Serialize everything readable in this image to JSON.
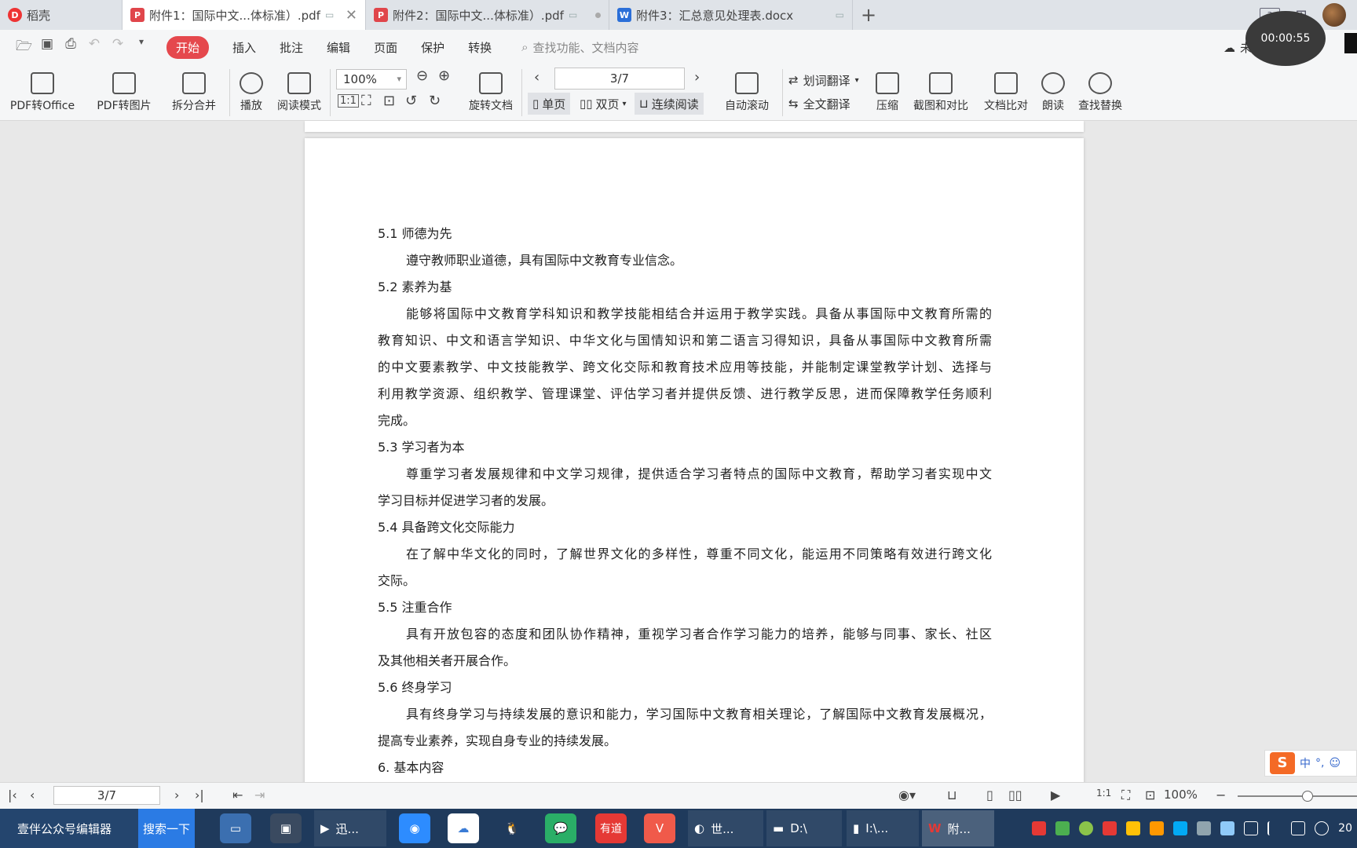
{
  "tabs": [
    {
      "label": "稻壳",
      "icon": "docer-icon"
    },
    {
      "label": "附件1：国际中文...体标准）.pdf",
      "icon": "pdf-icon",
      "active": true
    },
    {
      "label": "附件2：国际中文...体标准）.pdf",
      "icon": "pdf-icon"
    },
    {
      "label": "附件3：汇总意见处理表.docx",
      "icon": "word-icon"
    }
  ],
  "tabbar_right": {
    "badge": "3"
  },
  "menu": {
    "items": [
      "开始",
      "插入",
      "批注",
      "编辑",
      "页面",
      "保护",
      "转换"
    ],
    "search_placeholder": "查找功能、文档内容",
    "sync": "未同步"
  },
  "timer": "00:00:55",
  "ribbon": {
    "pdf_to_office": "PDF转Office",
    "pdf_to_image": "PDF转图片",
    "split_merge": "拆分合并",
    "play": "播放",
    "read_mode": "阅读模式",
    "zoom": "100%",
    "rotate": "旋转文档",
    "page_indicator": "3/7",
    "single_page": "单页",
    "double_page": "双页",
    "continuous": "连续阅读",
    "auto_scroll": "自动滚动",
    "word_translate": "划词翻译",
    "full_translate": "全文翻译",
    "compress": "压缩",
    "screenshot_compare": "截图和对比",
    "doc_compare": "文档比对",
    "read_aloud": "朗读",
    "find_replace": "查找替换"
  },
  "document": {
    "lines": [
      {
        "type": "h",
        "text": "5.1  师德为先"
      },
      {
        "type": "b",
        "text": "遵守教师职业道德，具有国际中文教育专业信念。"
      },
      {
        "type": "h",
        "text": "5.2  素养为基"
      },
      {
        "type": "bj",
        "text": "能够将国际中文教育学科知识和教学技能相结合并运用于教学实践。具备从事国际中文教育所需的"
      },
      {
        "type": "cj",
        "text": "教育知识、中文和语言学知识、中华文化与国情知识和第二语言习得知识，具备从事国际中文教育所需"
      },
      {
        "type": "cj",
        "text": "的中文要素教学、中文技能教学、跨文化交际和教育技术应用等技能，并能制定课堂教学计划、选择与"
      },
      {
        "type": "cj",
        "text": "利用教学资源、组织教学、管理课堂、评估学习者并提供反馈、进行教学反思，进而保障教学任务顺利"
      },
      {
        "type": "c",
        "text": "完成。"
      },
      {
        "type": "h",
        "text": "5.3  学习者为本"
      },
      {
        "type": "bj",
        "text": "尊重学习者发展规律和中文学习规律，提供适合学习者特点的国际中文教育，帮助学习者实现中文"
      },
      {
        "type": "c",
        "text": "学习目标并促进学习者的发展。"
      },
      {
        "type": "h",
        "text": "5.4 具备跨文化交际能力"
      },
      {
        "type": "bj",
        "text": "在了解中华文化的同时，了解世界文化的多样性，尊重不同文化，能运用不同策略有效进行跨文化"
      },
      {
        "type": "c",
        "text": "交际。"
      },
      {
        "type": "h",
        "text": "5.5  注重合作"
      },
      {
        "type": "bj",
        "text": "具有开放包容的态度和团队协作精神，重视学习者合作学习能力的培养，能够与同事、家长、社区"
      },
      {
        "type": "c",
        "text": "及其他相关者开展合作。"
      },
      {
        "type": "h",
        "text": "5.6  终身学习"
      },
      {
        "type": "bj",
        "text": "具有终身学习与持续发展的意识和能力，学习国际中文教育相关理论，了解国际中文教育发展概况，"
      },
      {
        "type": "c",
        "text": "提高专业素养，实现自身专业的持续发展。"
      },
      {
        "type": "h",
        "text": "6. 基本内容"
      }
    ]
  },
  "ime": {
    "lang": "中"
  },
  "status": {
    "page": "3/7",
    "zoom": "100%"
  },
  "taskbar": {
    "editor": "壹伴公众号编辑器",
    "search": "搜索一下",
    "windows": [
      {
        "label": "迅..."
      },
      {
        "label": "世..."
      },
      {
        "label": "D:\\"
      },
      {
        "label": "I:\\..."
      },
      {
        "label": "附..."
      }
    ],
    "youdao": "有道",
    "clock": "20"
  }
}
